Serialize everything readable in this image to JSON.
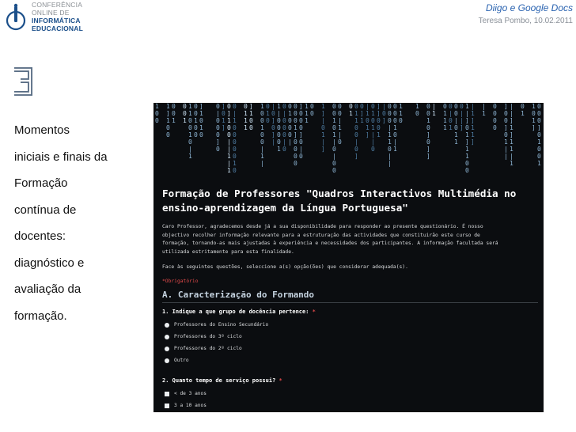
{
  "logo": {
    "lines": [
      "CONFERÊNCIA",
      "ONLINE DE",
      "INFORMÁTICA",
      "EDUCACIONAL"
    ]
  },
  "header": {
    "title": "Diigo e Google Docs",
    "subtitle": "Teresa Pombo, 10.02.2011"
  },
  "slide": {
    "number": "3",
    "lines": [
      "Momentos",
      "iniciais e finais da",
      "Formação",
      "contínua de",
      "docentes:",
      "diagnóstico e",
      "avaliação da",
      "formação."
    ]
  },
  "form": {
    "title_line1": "Formação de Professores \"Quadros Interactivos Multimédia no",
    "title_line2": "ensino-aprendizagem da Língua Portuguesa\"",
    "desc_line1": "Caro Professor, agradecemos desde já a sua disponibilidade para responder ao presente questionário. É nosso",
    "desc_line2": "objectivo recolher informação relevante para a estruturação das actividades que constituirão este curso de",
    "desc_line3": "formação, tornando-as mais ajustadas à experiência e necessidades dos participantes. A informação facultada será",
    "desc_line4": "utilizada estritamente para esta finalidade.",
    "instruction": "Face às seguintes questões, seleccione a(s) opção(ões) que considerar adequada(s).",
    "required_note": "*Obrigatório",
    "section": "A. Caracterização do Formando",
    "q1": {
      "text": "1. Indique a que grupo de docência pertence:",
      "star": "*",
      "options": [
        "Professores do Ensino Secundário",
        "Professores do 3º ciclo",
        "Professores do 2º ciclo",
        "Outro"
      ]
    },
    "q2": {
      "text": "2. Quanto tempo de serviço possui?",
      "star": "*",
      "options": [
        "< de 3 anos",
        "3 a 10 anos"
      ]
    }
  },
  "colors": {
    "header_blue": "#2a63b0",
    "logo_blue": "#1b4f8a",
    "panel_bg": "#0b0d10",
    "required_red": "#e04a4a"
  }
}
